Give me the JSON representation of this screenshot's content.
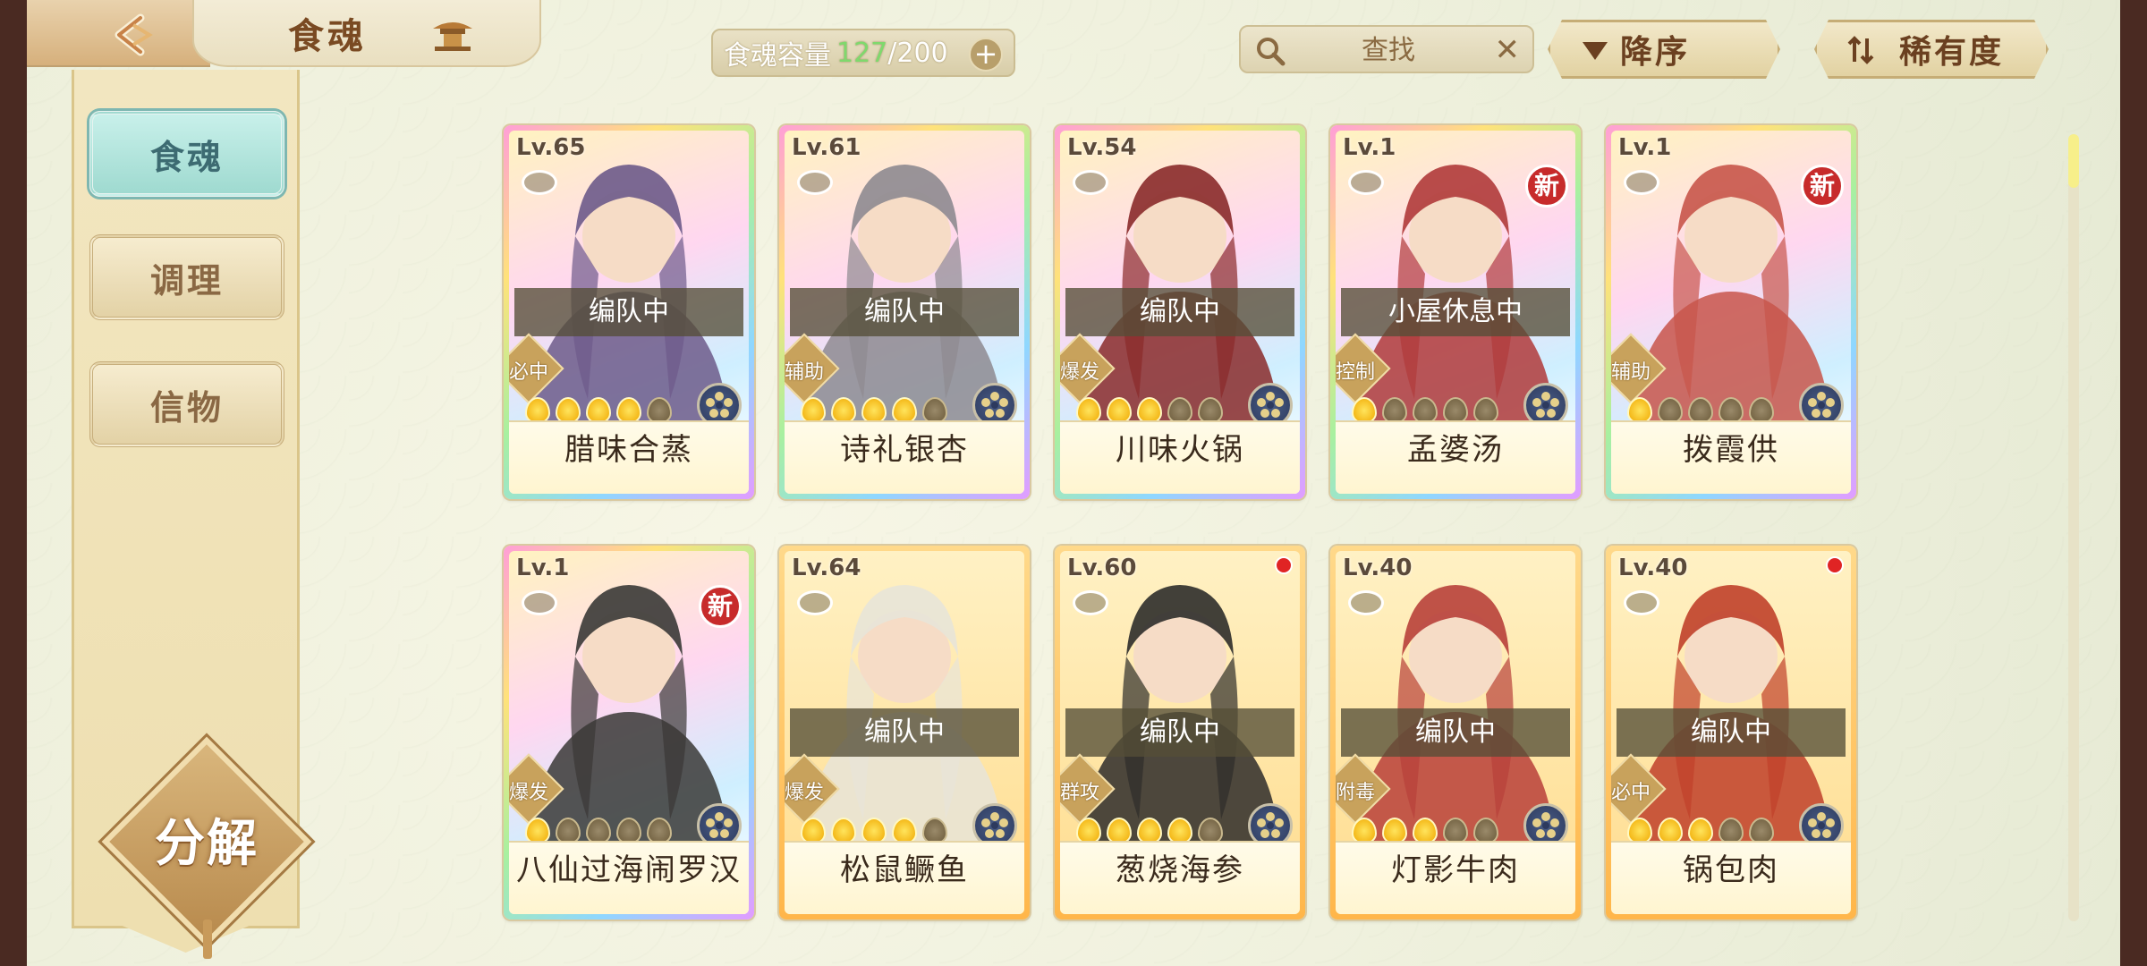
{
  "header": {
    "title": "食魂",
    "capacity_label": "食魂容量",
    "capacity_current": "127",
    "capacity_max": "/200",
    "search_placeholder": "查找",
    "sort_label": "降序",
    "rarity_label": "稀有度"
  },
  "sidebar": {
    "items": [
      {
        "label": "食魂",
        "active": true
      },
      {
        "label": "调理",
        "active": false
      },
      {
        "label": "信物",
        "active": false
      }
    ],
    "decompose_label": "分解"
  },
  "cards": [
    {
      "level": "Lv.65",
      "status": "编队中",
      "role": "必中",
      "name": "腊味合蒸",
      "stars": 4,
      "frame": "rainbow",
      "new": false,
      "dot": false,
      "tone": "#6d5a8a"
    },
    {
      "level": "Lv.61",
      "status": "编队中",
      "role": "辅助",
      "name": "诗礼银杏",
      "stars": 4,
      "frame": "rainbow",
      "new": false,
      "dot": false,
      "tone": "#8e8a90"
    },
    {
      "level": "Lv.54",
      "status": "编队中",
      "role": "爆发",
      "name": "川味火锅",
      "stars": 3,
      "frame": "rainbow",
      "new": false,
      "dot": false,
      "tone": "#8a2a2a"
    },
    {
      "level": "Lv.1",
      "status": "小屋休息中",
      "role": "控制",
      "name": "孟婆汤",
      "stars": 1,
      "frame": "rainbow",
      "new": true,
      "dot": false,
      "tone": "#b03a3a"
    },
    {
      "level": "Lv.1",
      "status": "",
      "role": "辅助",
      "name": "拨霞供",
      "stars": 1,
      "frame": "rainbow",
      "new": true,
      "dot": false,
      "tone": "#c8554a"
    },
    {
      "level": "Lv.1",
      "status": "",
      "role": "爆发",
      "name": "八仙过海闹罗汉",
      "stars": 1,
      "frame": "rainbow",
      "new": true,
      "dot": false,
      "tone": "#3a3836"
    },
    {
      "level": "Lv.64",
      "status": "编队中",
      "role": "爆发",
      "name": "松鼠鳜鱼",
      "stars": 4,
      "frame": "gold",
      "new": false,
      "dot": false,
      "tone": "#e8e4d8"
    },
    {
      "level": "Lv.60",
      "status": "编队中",
      "role": "群攻",
      "name": "葱烧海参",
      "stars": 4,
      "frame": "gold",
      "new": false,
      "dot": true,
      "tone": "#2e2c2a"
    },
    {
      "level": "Lv.40",
      "status": "编队中",
      "role": "附毒",
      "name": "灯影牛肉",
      "stars": 3,
      "frame": "gold",
      "new": false,
      "dot": false,
      "tone": "#b8403a"
    },
    {
      "level": "Lv.40",
      "status": "编队中",
      "role": "必中",
      "name": "锅包肉",
      "stars": 3,
      "frame": "gold",
      "new": false,
      "dot": true,
      "tone": "#c0402a"
    }
  ],
  "new_badge_label": "新",
  "colors": {
    "accent": "#7eb7b1",
    "frame_gold": "#ffb64a",
    "status_overlay": "#554e37"
  }
}
